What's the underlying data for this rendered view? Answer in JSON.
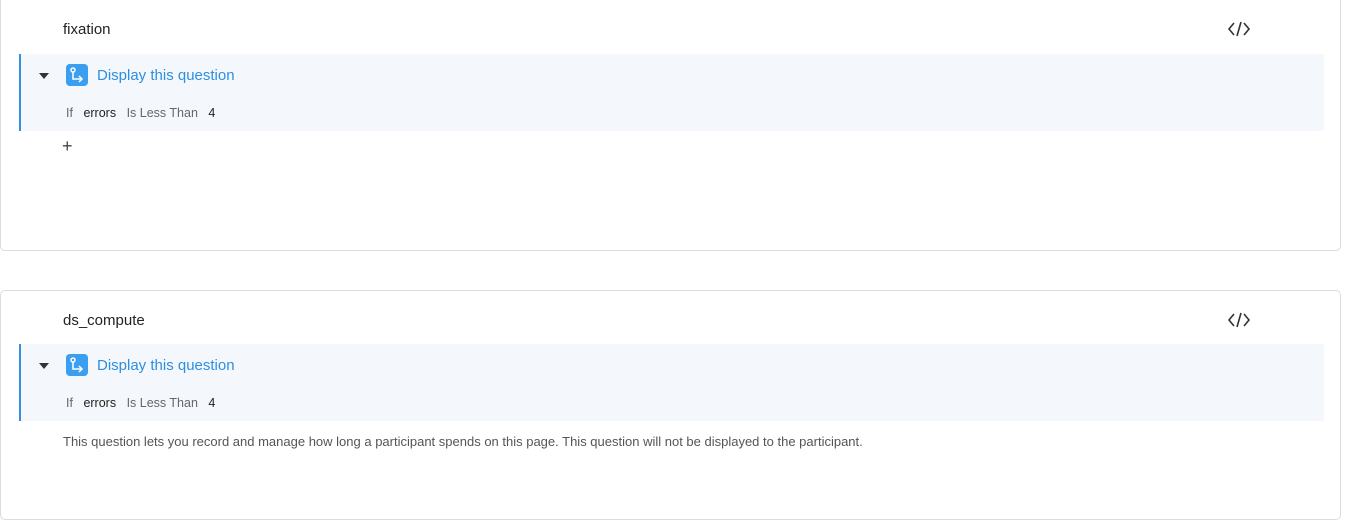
{
  "questions": [
    {
      "id": "fixation",
      "logic": {
        "title": "Display this question",
        "condition": {
          "if": "If",
          "field": "errors",
          "operator": "Is Less Than",
          "value": "4"
        }
      },
      "add_label": "+"
    },
    {
      "id": "ds_compute",
      "logic": {
        "title": "Display this question",
        "condition": {
          "if": "If",
          "field": "errors",
          "operator": "Is Less Than",
          "value": "4"
        }
      },
      "description": "This question lets you record and manage how long a participant spends on this page. This question will not be displayed to the participant."
    }
  ],
  "icons": {
    "code": "code-icon",
    "logic": "display-logic-icon",
    "caret": "caret-down-icon"
  },
  "colors": {
    "accent": "#3a8fd9",
    "logic_icon_bg": "#3a9ff0",
    "logic_block_bg": "#f4f8fc"
  }
}
